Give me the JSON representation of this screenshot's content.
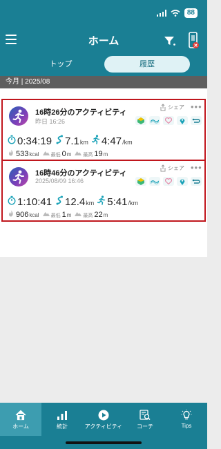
{
  "status_bar": {
    "battery": "88"
  },
  "header": {
    "title": "ホーム"
  },
  "tabs": [
    {
      "label": "トップ",
      "selected": false
    },
    {
      "label": "履歴",
      "selected": true
    }
  ],
  "month_bar": {
    "label": "今月 | 2025/08"
  },
  "activities": [
    {
      "title": "16時26分のアクティビティ",
      "date": "昨日 16:26",
      "share_label": "シェア",
      "duration": "0:34:19",
      "distance": "7.1",
      "distance_unit": "km",
      "pace": "4:47",
      "pace_unit": "/km",
      "calories": "533",
      "calories_unit": "kcal",
      "min_label": "最低",
      "min_elev": "0",
      "min_unit": "m",
      "max_label": "最高",
      "max_elev": "19",
      "max_unit": "m"
    },
    {
      "title": "16時46分のアクティビティ",
      "date": "2025/08/09 16:46",
      "share_label": "シェア",
      "duration": "1:10:41",
      "distance": "12.4",
      "distance_unit": "km",
      "pace": "5:41",
      "pace_unit": "/km",
      "calories": "906",
      "calories_unit": "kcal",
      "min_label": "最低",
      "min_elev": "1",
      "min_unit": "m",
      "max_label": "最高",
      "max_elev": "22",
      "max_unit": "m"
    }
  ],
  "bottom_nav": [
    {
      "label": "ホーム",
      "icon": "home-icon",
      "active": true
    },
    {
      "label": "統計",
      "icon": "stats-icon",
      "active": false
    },
    {
      "label": "アクティビティ",
      "icon": "play-icon",
      "active": false
    },
    {
      "label": "コーチ",
      "icon": "coach-icon",
      "active": false
    },
    {
      "label": "Tips",
      "icon": "bulb-icon",
      "active": false
    }
  ],
  "colors": {
    "brand": "#1a7f94",
    "highlight_border": "#c0161d",
    "accent": "#1aa2b8"
  }
}
